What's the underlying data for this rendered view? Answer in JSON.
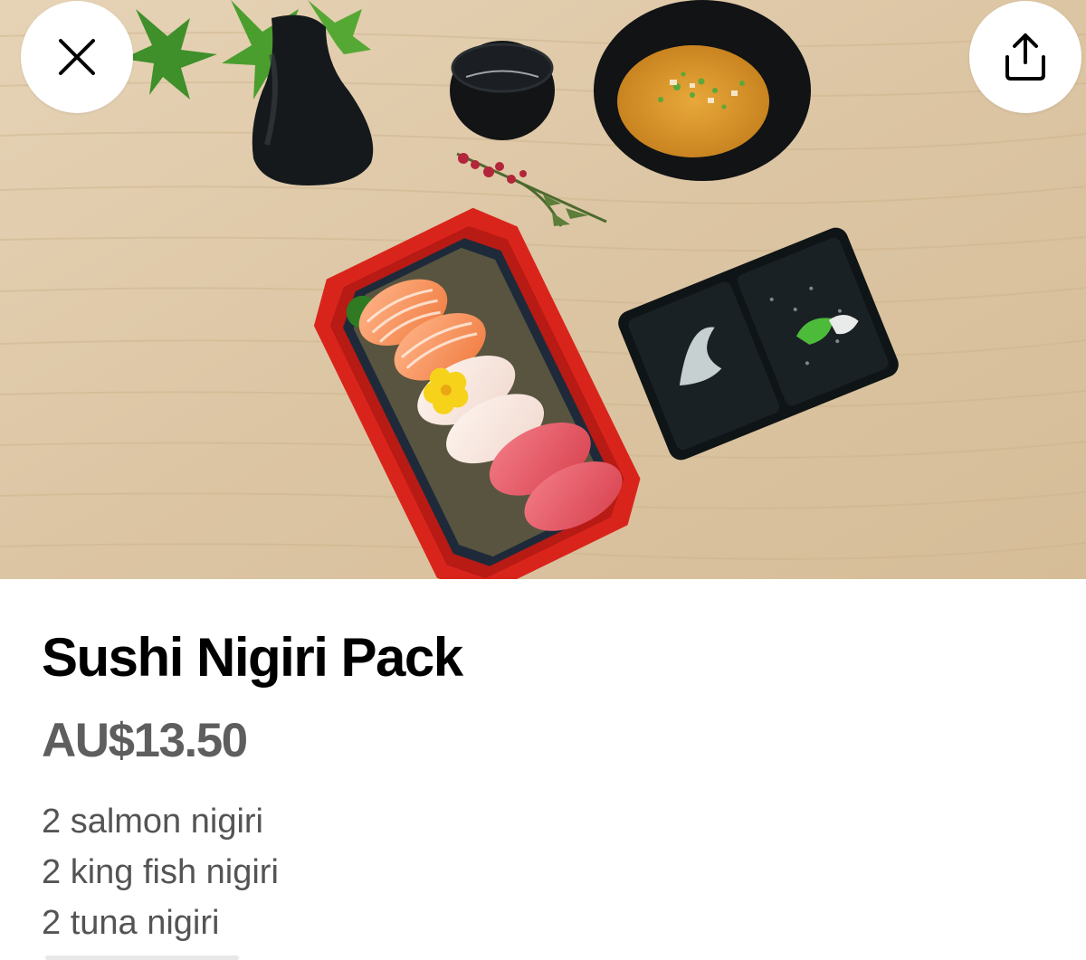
{
  "hero": {
    "alt": "Sushi nigiri pack with soup, cup and sauce dish on a wooden table"
  },
  "actions": {
    "close_icon": "close-icon",
    "share_icon": "share-icon"
  },
  "item": {
    "title": "Sushi Nigiri Pack",
    "price": "AU$13.50",
    "description": [
      "2 salmon nigiri",
      "2 king fish nigiri",
      "2 tuna nigiri"
    ]
  },
  "colors": {
    "background": "#ffffff",
    "title": "#000000",
    "price": "#5e5e5e",
    "description": "#545454",
    "wood": "#dcc5a4",
    "tray_red": "#e0281e"
  }
}
